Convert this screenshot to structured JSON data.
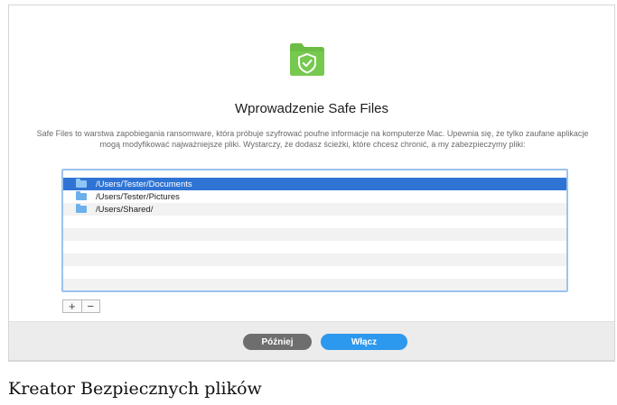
{
  "dialog": {
    "title": "Wprowadzenie Safe Files",
    "description": "Safe Files to warstwa zapobiegania ransomware, która próbuje szyfrować poufne informacje na komputerze Mac. Upewnia się, że tylko zaufane aplikacje mogą modyfikować najważniejsze pliki. Wystarczy, że dodasz ścieżki, które chcesz chronić, a my zabezpieczymy pliki:",
    "paths": [
      {
        "path": "/Users/Tester/Documents",
        "selected": true
      },
      {
        "path": "/Users/Tester/Pictures",
        "selected": false
      },
      {
        "path": "/Users/Shared/",
        "selected": false
      }
    ],
    "add_label": "+",
    "remove_label": "−",
    "later_label": "Później",
    "enable_label": "Włącz"
  },
  "caption": "Kreator Bezpiecznych plików",
  "icons": {
    "header": "folder-shield-icon",
    "row": "folder-icon"
  },
  "colors": {
    "brand_green": "#6cbd45",
    "selection_blue": "#2f74d5",
    "enable_button": "#2c98ee",
    "later_button": "#6e6e6e"
  }
}
